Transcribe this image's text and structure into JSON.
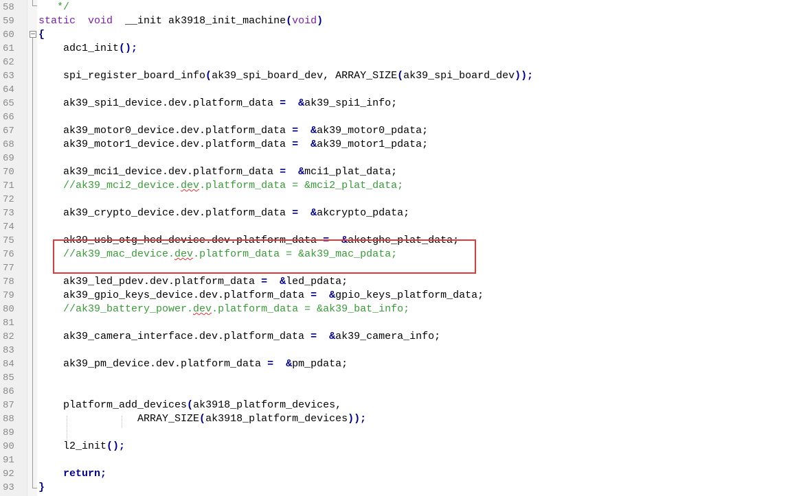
{
  "editor": {
    "lines": [
      {
        "num": "58",
        "tokens": [
          [
            "cm",
            "   */"
          ]
        ]
      },
      {
        "num": "59",
        "tokens": [
          [
            "kw",
            "static"
          ],
          [
            "",
            "  "
          ],
          [
            "kw",
            "void"
          ],
          [
            "",
            "  __init ak3918_init_machine"
          ],
          [
            "op",
            "("
          ],
          [
            "kw",
            "void"
          ],
          [
            "op",
            ")"
          ]
        ]
      },
      {
        "num": "60",
        "tokens": [
          [
            "op",
            "{"
          ]
        ]
      },
      {
        "num": "61",
        "tokens": [
          [
            "",
            "    adc1_init"
          ],
          [
            "op",
            "();"
          ]
        ]
      },
      {
        "num": "62",
        "tokens": []
      },
      {
        "num": "63",
        "tokens": [
          [
            "",
            "    spi_register_board_info"
          ],
          [
            "op",
            "("
          ],
          [
            "",
            "ak39_spi_board_dev, ARRAY_SIZE"
          ],
          [
            "op",
            "("
          ],
          [
            "",
            "ak39_spi_board_dev"
          ],
          [
            "op",
            "));"
          ]
        ]
      },
      {
        "num": "64",
        "tokens": []
      },
      {
        "num": "65",
        "tokens": [
          [
            "",
            "    ak39_spi1_device.dev.platform_data "
          ],
          [
            "op",
            "="
          ],
          [
            "",
            "  "
          ],
          [
            "op",
            "&"
          ],
          [
            "",
            "ak39_spi1_info;"
          ]
        ]
      },
      {
        "num": "66",
        "tokens": []
      },
      {
        "num": "67",
        "tokens": [
          [
            "",
            "    ak39_motor0_device.dev.platform_data "
          ],
          [
            "op",
            "="
          ],
          [
            "",
            "  "
          ],
          [
            "op",
            "&"
          ],
          [
            "",
            "ak39_motor0_pdata;"
          ]
        ]
      },
      {
        "num": "68",
        "tokens": [
          [
            "",
            "    ak39_motor1_device.dev.platform_data "
          ],
          [
            "op",
            "="
          ],
          [
            "",
            "  "
          ],
          [
            "op",
            "&"
          ],
          [
            "",
            "ak39_motor1_pdata;"
          ]
        ]
      },
      {
        "num": "69",
        "tokens": []
      },
      {
        "num": "70",
        "tokens": [
          [
            "",
            "    ak39_mci1_device.dev.platform_data "
          ],
          [
            "op",
            "="
          ],
          [
            "",
            "  "
          ],
          [
            "op",
            "&"
          ],
          [
            "",
            "mci1_plat_data;"
          ]
        ]
      },
      {
        "num": "71",
        "tokens": [
          [
            "cm",
            "    //ak39_mci2_device."
          ],
          [
            "cmsq",
            "dev"
          ],
          [
            "cm",
            ".platform_data = &mci2_plat_data;"
          ]
        ]
      },
      {
        "num": "72",
        "tokens": []
      },
      {
        "num": "73",
        "tokens": [
          [
            "",
            "    ak39_crypto_device.dev.platform_data "
          ],
          [
            "op",
            "="
          ],
          [
            "",
            "  "
          ],
          [
            "op",
            "&"
          ],
          [
            "",
            "akcrypto_pdata;"
          ]
        ]
      },
      {
        "num": "74",
        "tokens": []
      },
      {
        "num": "75",
        "tokens": [
          [
            "",
            "    ak39_usb_otg_hcd_device.dev.platform_data "
          ],
          [
            "op",
            "="
          ],
          [
            "",
            "  "
          ],
          [
            "op",
            "&"
          ],
          [
            "",
            "akotghc_plat_data;"
          ]
        ]
      },
      {
        "num": "76",
        "tokens": [
          [
            "cm",
            "    //ak39_mac_device."
          ],
          [
            "cmsq",
            "dev"
          ],
          [
            "cm",
            ".platform_data = &ak39_mac_pdata;"
          ]
        ]
      },
      {
        "num": "77",
        "tokens": []
      },
      {
        "num": "78",
        "tokens": [
          [
            "",
            "    ak39_led_pdev.dev.platform_data "
          ],
          [
            "op",
            "="
          ],
          [
            "",
            "  "
          ],
          [
            "op",
            "&"
          ],
          [
            "",
            "led_pdata;"
          ]
        ]
      },
      {
        "num": "79",
        "tokens": [
          [
            "",
            "    ak39_gpio_keys_device.dev.platform_data "
          ],
          [
            "op",
            "="
          ],
          [
            "",
            "  "
          ],
          [
            "op",
            "&"
          ],
          [
            "",
            "gpio_keys_platform_data;"
          ]
        ]
      },
      {
        "num": "80",
        "tokens": [
          [
            "cm",
            "    //ak39_battery_power."
          ],
          [
            "cmsq",
            "dev"
          ],
          [
            "cm",
            ".platform_data = &ak39_bat_info;"
          ]
        ]
      },
      {
        "num": "81",
        "tokens": []
      },
      {
        "num": "82",
        "tokens": [
          [
            "",
            "    ak39_camera_interface.dev.platform_data "
          ],
          [
            "op",
            "="
          ],
          [
            "",
            "  "
          ],
          [
            "op",
            "&"
          ],
          [
            "",
            "ak39_camera_info;"
          ]
        ]
      },
      {
        "num": "83",
        "tokens": []
      },
      {
        "num": "84",
        "tokens": [
          [
            "",
            "    ak39_pm_device.dev.platform_data "
          ],
          [
            "op",
            "="
          ],
          [
            "",
            "  "
          ],
          [
            "op",
            "&"
          ],
          [
            "",
            "pm_pdata;"
          ]
        ]
      },
      {
        "num": "85",
        "tokens": []
      },
      {
        "num": "86",
        "tokens": []
      },
      {
        "num": "87",
        "tokens": [
          [
            "",
            "    platform_add_devices"
          ],
          [
            "op",
            "("
          ],
          [
            "",
            "ak3918_platform_devices,"
          ]
        ]
      },
      {
        "num": "88",
        "tokens": [
          [
            "",
            "                ARRAY_SIZE"
          ],
          [
            "op",
            "("
          ],
          [
            "",
            "ak3918_platform_devices"
          ],
          [
            "op",
            "));"
          ]
        ]
      },
      {
        "num": "89",
        "tokens": []
      },
      {
        "num": "90",
        "tokens": [
          [
            "",
            "    l2_init"
          ],
          [
            "op",
            "();"
          ]
        ]
      },
      {
        "num": "91",
        "tokens": []
      },
      {
        "num": "92",
        "tokens": [
          [
            "kwb",
            "    return"
          ],
          [
            "op",
            ";"
          ]
        ]
      },
      {
        "num": "93",
        "tokens": [
          [
            "op",
            "}"
          ]
        ]
      }
    ]
  },
  "colors": {
    "keyword": "#7a1fa2",
    "operator": "#000080",
    "comment": "#3a9a3a",
    "highlight_box": "#e0393a"
  },
  "icons": {
    "fold_open": "minus-box-icon"
  }
}
